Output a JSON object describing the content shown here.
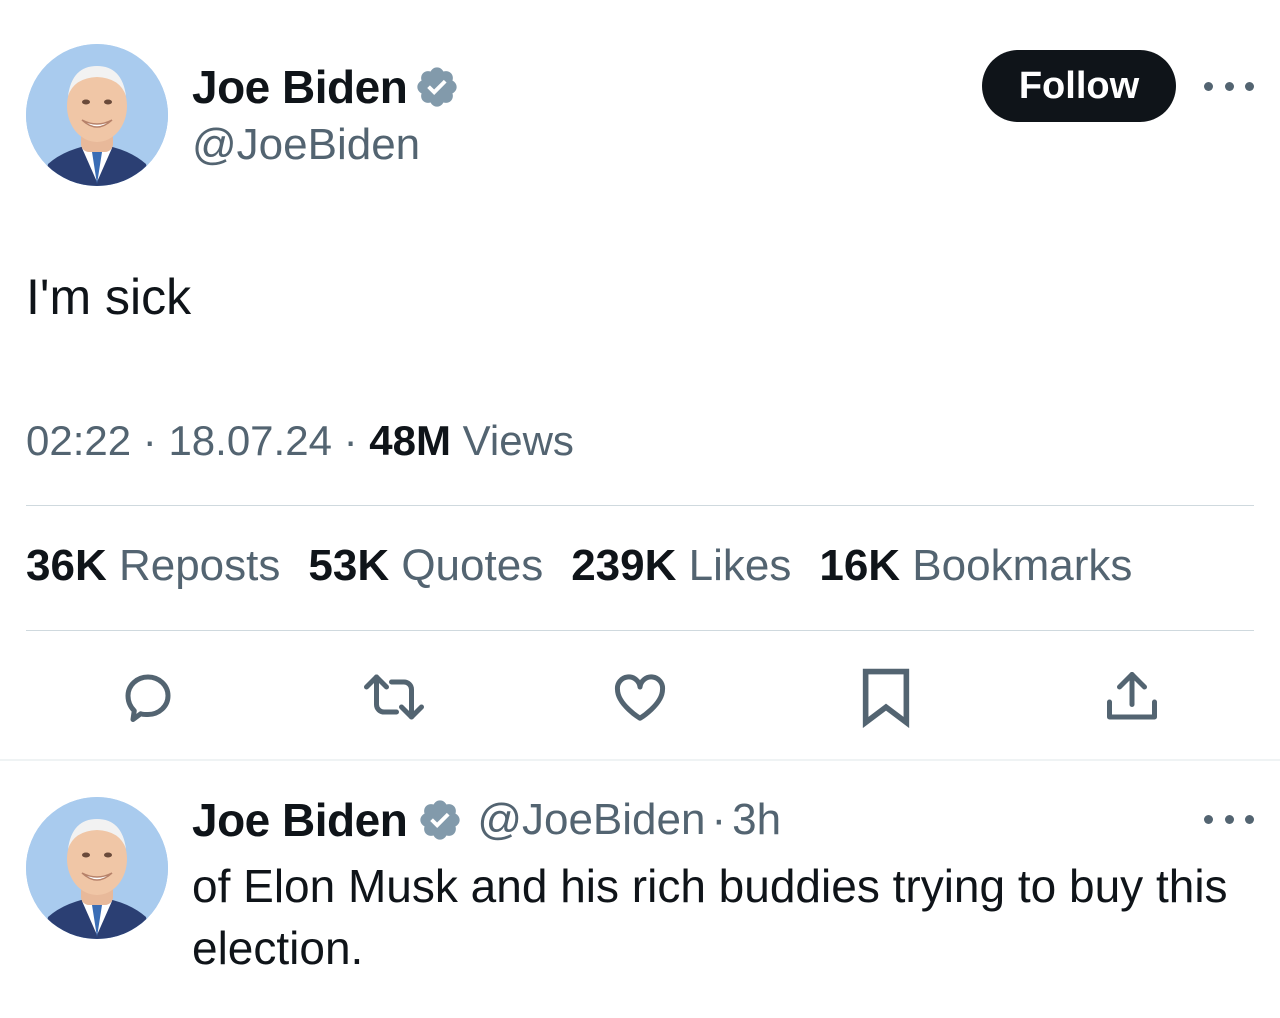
{
  "tweet": {
    "author_name": "Joe Biden",
    "author_handle": "@JoeBiden",
    "follow_label": "Follow",
    "text": "I'm sick",
    "time": "02:22",
    "date": "18.07.24",
    "views_count": "48M",
    "views_label": "Views",
    "stats": [
      {
        "count": "36K",
        "label": "Reposts"
      },
      {
        "count": "53K",
        "label": "Quotes"
      },
      {
        "count": "239K",
        "label": "Likes"
      },
      {
        "count": "16K",
        "label": "Bookmarks"
      }
    ],
    "actions": [
      "reply-icon",
      "repost-icon",
      "like-icon",
      "bookmark-icon",
      "share-icon"
    ]
  },
  "reply": {
    "author_name": "Joe Biden",
    "author_handle": "@JoeBiden",
    "age": "3h",
    "text": "of Elon Musk and his rich buddies trying to buy this election."
  },
  "colors": {
    "text_primary": "#0f1419",
    "text_secondary": "#536471",
    "verified": "#829aab",
    "divider": "#cfd9de",
    "follow_bg": "#0f1419"
  }
}
